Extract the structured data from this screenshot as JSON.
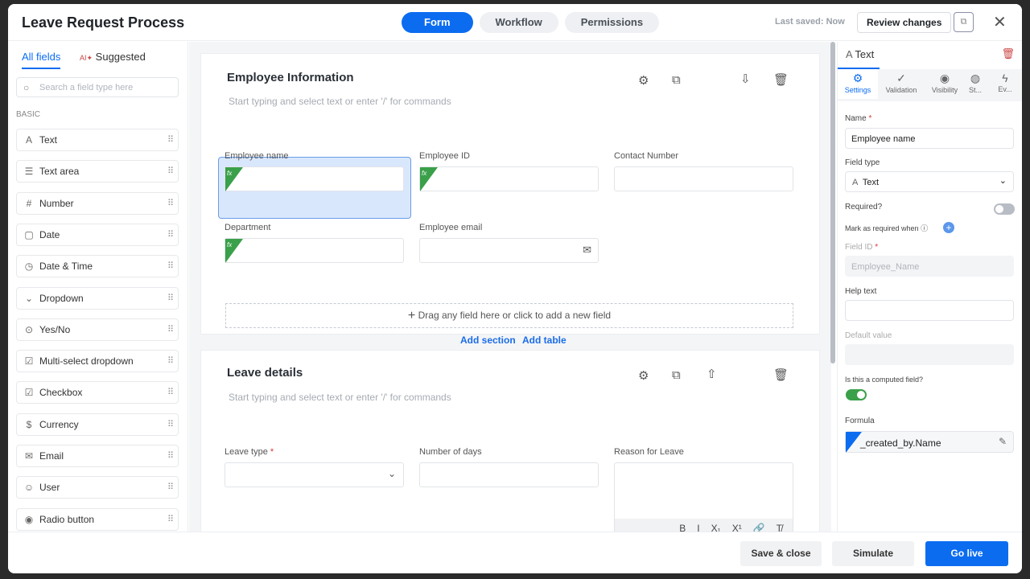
{
  "header": {
    "title": "Leave Request Process",
    "tabs": [
      "Form",
      "Workflow",
      "Permissions"
    ],
    "last_saved": "Last saved: Now",
    "review_label": "Review changes",
    "close": "✕"
  },
  "left": {
    "tabs": [
      "All fields",
      "Suggested"
    ],
    "search_placeholder": "Search a field type here",
    "group": "BASIC",
    "items": [
      {
        "label": "Text",
        "icon": "A"
      },
      {
        "label": "Text area",
        "icon": "☰"
      },
      {
        "label": "Number",
        "icon": "#"
      },
      {
        "label": "Date",
        "icon": "▢"
      },
      {
        "label": "Date & Time",
        "icon": "◷"
      },
      {
        "label": "Dropdown",
        "icon": "⌄"
      },
      {
        "label": "Yes/No",
        "icon": "⊙"
      },
      {
        "label": "Multi-select dropdown",
        "icon": "☑"
      },
      {
        "label": "Checkbox",
        "icon": "☑"
      },
      {
        "label": "Currency",
        "icon": "$"
      },
      {
        "label": "Email",
        "icon": "✉"
      },
      {
        "label": "User",
        "icon": "☺"
      },
      {
        "label": "Radio button",
        "icon": "◉"
      }
    ]
  },
  "sections": [
    {
      "title": "Employee Information",
      "hint": "Start typing and select text or enter '/' for commands",
      "fields": [
        {
          "label": "Employee name"
        },
        {
          "label": "Employee ID"
        },
        {
          "label": "Contact Number"
        },
        {
          "label": "Department"
        },
        {
          "label": "Employee email"
        }
      ]
    },
    {
      "title": "Leave details",
      "hint": "Start typing and select text or enter '/' for commands",
      "fields": [
        {
          "label": "Leave type",
          "required": "*"
        },
        {
          "label": "Number of days"
        },
        {
          "label": "Reason for Leave"
        }
      ]
    }
  ],
  "dropzone": "Drag any field here or click to add a new field",
  "add_section": "Add section",
  "add_table": "Add table",
  "fx": "fx",
  "rte": [
    "B",
    "I",
    "X₁",
    "X¹",
    "🔗",
    "T̸"
  ],
  "right": {
    "title": "Text",
    "tabs": [
      "Settings",
      "Validation",
      "Visibility",
      "St...",
      "Ev..."
    ],
    "name_label": "Name",
    "name_value": "Employee name",
    "field_type_label": "Field type",
    "field_type_value": "Text",
    "required_label": "Required?",
    "required_on": false,
    "mark_required": "Mark as required when",
    "field_id_label": "Field ID",
    "field_id_value": "Employee_Name",
    "help_label": "Help text",
    "default_label": "Default value",
    "computed_label": "Is this a computed field?",
    "computed_on": true,
    "formula_label": "Formula",
    "formula_value": "_created_by.Name",
    "star": "*"
  },
  "footer": {
    "save": "Save & close",
    "simulate": "Simulate",
    "golive": "Go live"
  },
  "colors": {
    "accent": "#0b6cf0",
    "fx_green": "#3aa04a",
    "toggle_on": "#3aa04a"
  }
}
